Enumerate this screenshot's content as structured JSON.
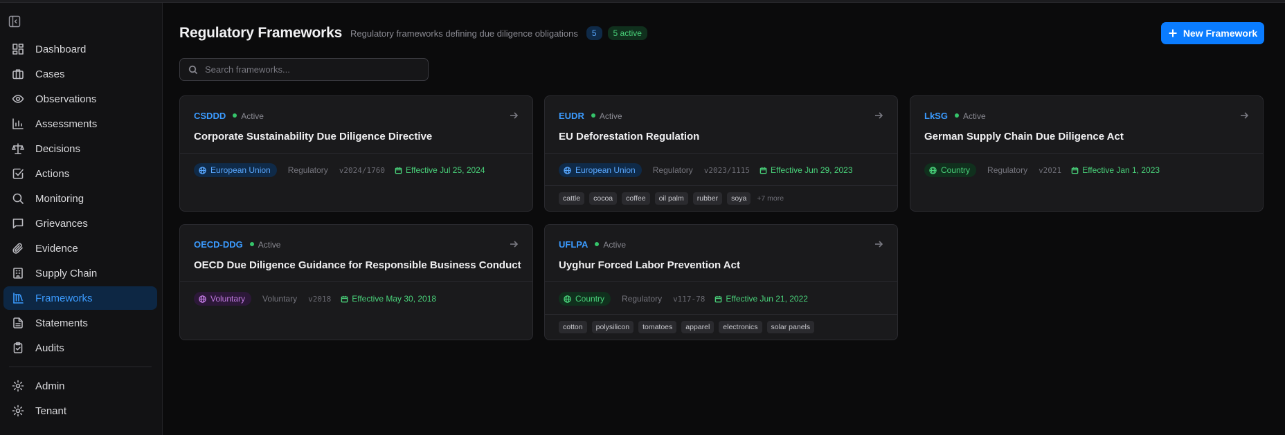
{
  "sidebar": {
    "items": [
      {
        "label": "Dashboard",
        "icon": "dashboard-icon"
      },
      {
        "label": "Cases",
        "icon": "briefcase-icon"
      },
      {
        "label": "Observations",
        "icon": "eye-icon"
      },
      {
        "label": "Assessments",
        "icon": "bar-chart-icon"
      },
      {
        "label": "Decisions",
        "icon": "scale-icon"
      },
      {
        "label": "Actions",
        "icon": "check-square-icon"
      },
      {
        "label": "Monitoring",
        "icon": "search-icon"
      },
      {
        "label": "Grievances",
        "icon": "message-icon"
      },
      {
        "label": "Evidence",
        "icon": "paperclip-icon"
      },
      {
        "label": "Supply Chain",
        "icon": "building-icon"
      },
      {
        "label": "Frameworks",
        "icon": "library-icon",
        "active": true
      },
      {
        "label": "Statements",
        "icon": "file-text-icon"
      },
      {
        "label": "Audits",
        "icon": "clipboard-check-icon"
      }
    ],
    "footer_items": [
      {
        "label": "Admin",
        "icon": "gear-icon"
      },
      {
        "label": "Tenant",
        "icon": "gear-icon"
      }
    ]
  },
  "header": {
    "title": "Regulatory Frameworks",
    "subtitle": "Regulatory frameworks defining due diligence obligations",
    "count": "5",
    "active_badge": "5 active",
    "new_button": "New Framework"
  },
  "search": {
    "placeholder": "Search frameworks..."
  },
  "colors": {
    "accent": "#0a7cff",
    "active_green": "#49d27a",
    "voluntary_purple": "#c07ae0"
  },
  "frameworks": [
    {
      "code": "CSDDD",
      "status": "Active",
      "name": "Corporate Sustainability Due Diligence Directive",
      "region": "European Union",
      "type": "Regulatory",
      "version": "v2024/1760",
      "effective": "Effective Jul 25, 2024",
      "tags": [],
      "more": ""
    },
    {
      "code": "EUDR",
      "status": "Active",
      "name": "EU Deforestation Regulation",
      "region": "European Union",
      "type": "Regulatory",
      "version": "v2023/1115",
      "effective": "Effective Jun 29, 2023",
      "tags": [
        "cattle",
        "cocoa",
        "coffee",
        "oil palm",
        "rubber",
        "soya"
      ],
      "more": "+7 more"
    },
    {
      "code": "LkSG",
      "status": "Active",
      "name": "German Supply Chain Due Diligence Act",
      "region": "Country",
      "type": "Regulatory",
      "version": "v2021",
      "effective": "Effective Jan 1, 2023",
      "tags": [],
      "more": ""
    },
    {
      "code": "OECD-DDG",
      "status": "Active",
      "name": "OECD Due Diligence Guidance for Responsible Business Conduct",
      "region": "Voluntary",
      "type": "Voluntary",
      "version": "v2018",
      "effective": "Effective May 30, 2018",
      "tags": [],
      "more": ""
    },
    {
      "code": "UFLPA",
      "status": "Active",
      "name": "Uyghur Forced Labor Prevention Act",
      "region": "Country",
      "type": "Regulatory",
      "version": "v117-78",
      "effective": "Effective Jun 21, 2022",
      "tags": [
        "cotton",
        "polysilicon",
        "tomatoes",
        "apparel",
        "electronics",
        "solar panels"
      ],
      "more": ""
    }
  ]
}
